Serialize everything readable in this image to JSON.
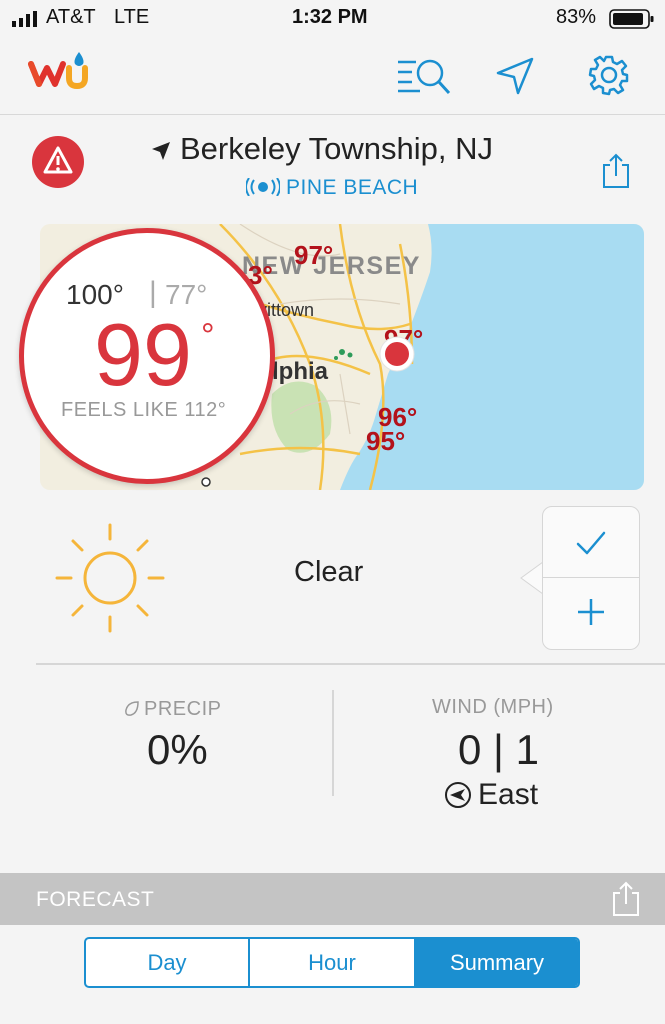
{
  "status_bar": {
    "carrier": "AT&T",
    "network": "LTE",
    "time": "1:32 PM",
    "battery": "83%"
  },
  "header": {
    "logo": "wu",
    "icons": [
      "search-list-icon",
      "location-arrow-icon",
      "gear-icon"
    ]
  },
  "location": {
    "name": "Berkeley Township, NJ",
    "station": "PINE BEACH"
  },
  "map": {
    "state_label": "NEW JERSEY",
    "city_labels": [
      "vittown",
      "lphia"
    ],
    "temps": [
      "97°",
      "3°",
      "97°",
      "96°",
      "95°"
    ]
  },
  "current": {
    "high": "100°",
    "low": "77°",
    "temp": "99",
    "degree": "°",
    "feels_like": "FEELS LIKE 112°",
    "condition": "Clear"
  },
  "stats": {
    "precip_label": "PRECIP",
    "precip_value": "0%",
    "wind_label": "WIND (MPH)",
    "wind_value": "0 | 1",
    "wind_dir": "East"
  },
  "forecast": {
    "label": "FORECAST",
    "tabs": [
      "Day",
      "Hour",
      "Summary"
    ],
    "selected_tab": "Summary"
  },
  "colors": {
    "accent": "#1b8fd0",
    "alert": "#d9353d",
    "map_temp": "#b3121b",
    "sun": "#f5b53a"
  }
}
